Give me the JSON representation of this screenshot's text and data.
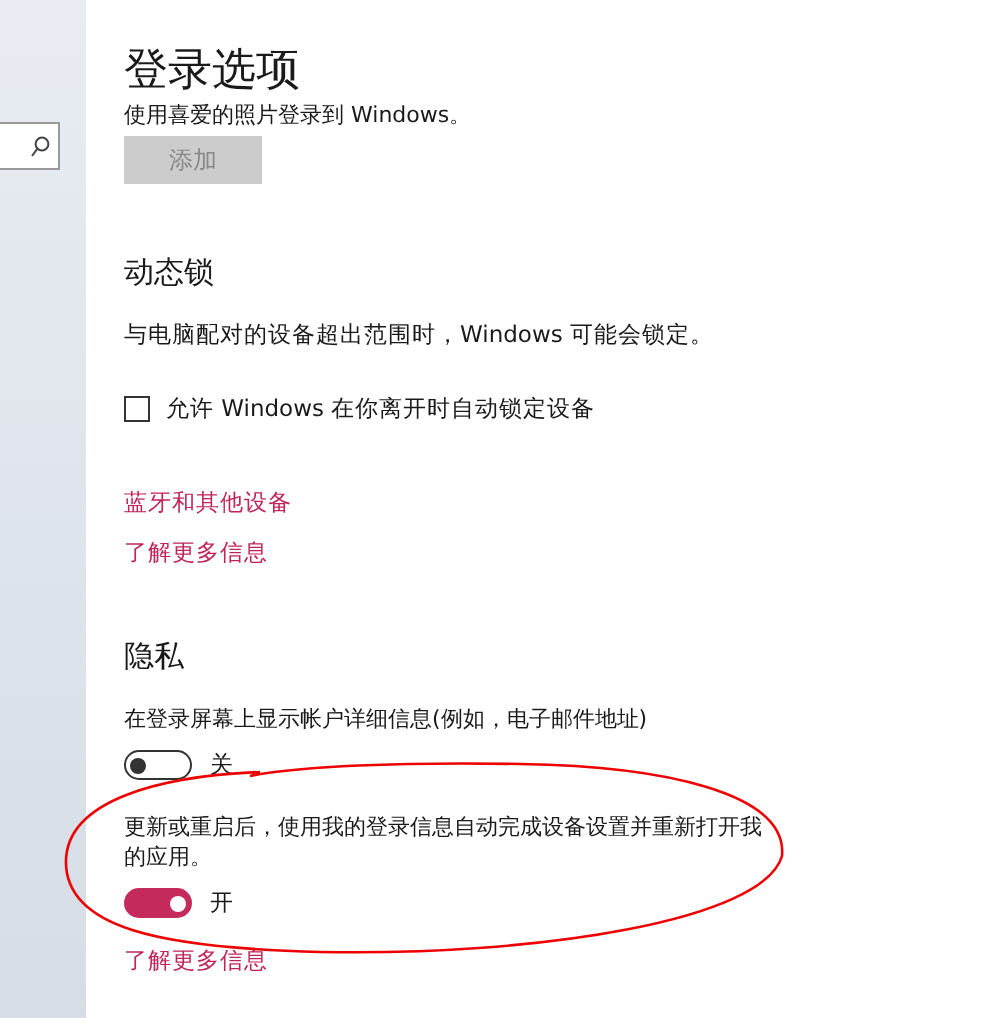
{
  "title": "登录选项",
  "picture_password": {
    "description": "使用喜爱的照片登录到 Windows。",
    "button": {
      "label": "添加",
      "disabled": true
    }
  },
  "dynamic_lock": {
    "heading": "动态锁",
    "description": "与电脑配对的设备超出范围时，Windows 可能会锁定。",
    "checkbox": {
      "label": "允许 Windows 在你离开时自动锁定设备",
      "checked": false
    },
    "links": [
      "蓝牙和其他设备",
      "了解更多信息"
    ]
  },
  "privacy": {
    "heading": "隐私",
    "settings": [
      {
        "description": "在登录屏幕上显示帐户详细信息(例如，电子邮件地址)",
        "on": false,
        "state_label": "关"
      },
      {
        "description": "更新或重启后，使用我的登录信息自动完成设备设置并重新打开我的应用。",
        "on": true,
        "state_label": "开"
      }
    ],
    "links": [
      "了解更多信息"
    ]
  }
}
